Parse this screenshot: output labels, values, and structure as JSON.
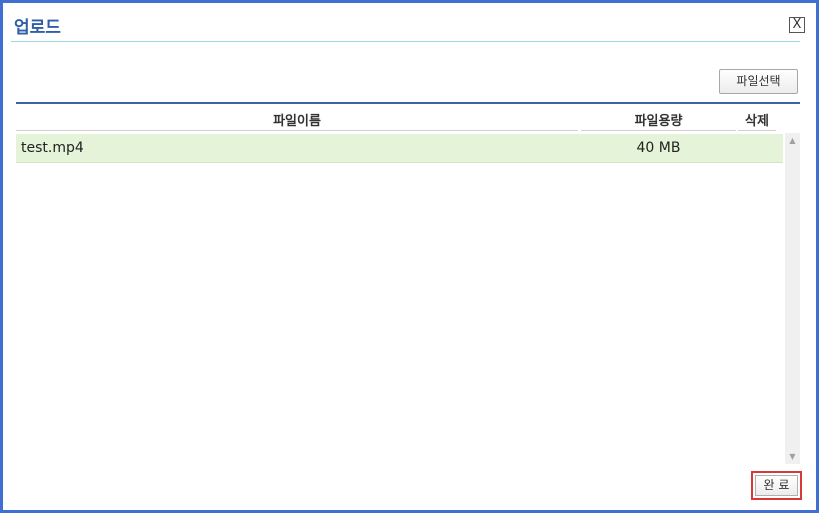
{
  "dialog": {
    "title": "업로드",
    "close_label": "X"
  },
  "toolbar": {
    "select_file_label": "파일선택"
  },
  "table": {
    "headers": {
      "name": "파일이름",
      "size": "파일용량",
      "delete": "삭제"
    },
    "rows": [
      {
        "name": "test.mp4",
        "size": "40 MB"
      }
    ]
  },
  "footer": {
    "done_label": "완 료"
  },
  "colors": {
    "frame_border": "#3f6fd1",
    "title_text": "#2f5fa8",
    "row_highlight": "#e5f4d8",
    "done_highlight": "#d9383a"
  }
}
